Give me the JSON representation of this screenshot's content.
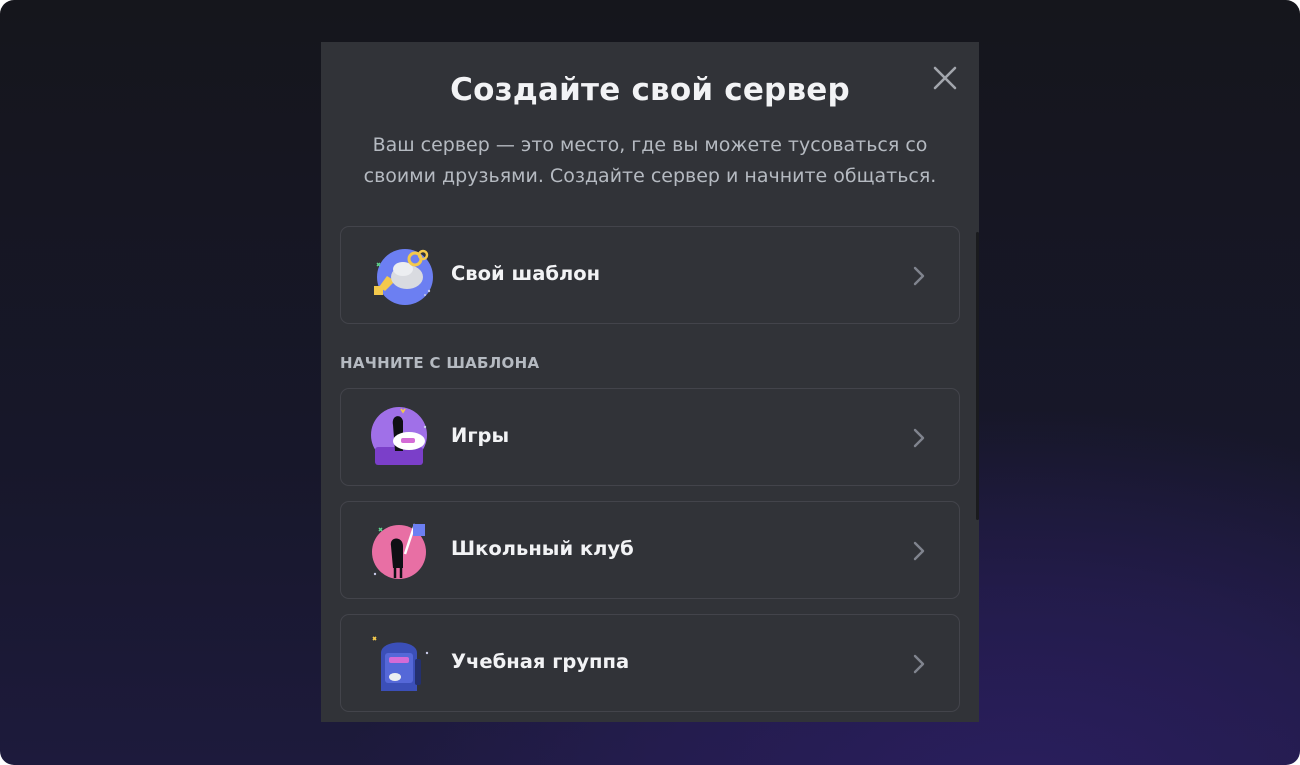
{
  "modal": {
    "title": "Создайте свой сервер",
    "subtitle": "Ваш сервер — это место, где вы можете тусоваться со своими друзьями. Создайте сервер и начните общаться.",
    "close_icon": "close-icon"
  },
  "custom_option": {
    "label": "Свой шаблон",
    "icon": "custom-template-icon"
  },
  "templates": {
    "header": "НАЧНИТЕ С ШАБЛОНА",
    "items": [
      {
        "label": "Игры",
        "icon": "gaming-icon"
      },
      {
        "label": "Школьный клуб",
        "icon": "school-club-icon"
      },
      {
        "label": "Учебная группа",
        "icon": "study-group-icon"
      }
    ]
  },
  "colors": {
    "modal_bg": "#313338",
    "title": "#f2f3f5",
    "subtitle": "#b5bac1",
    "border": "#43444b"
  }
}
